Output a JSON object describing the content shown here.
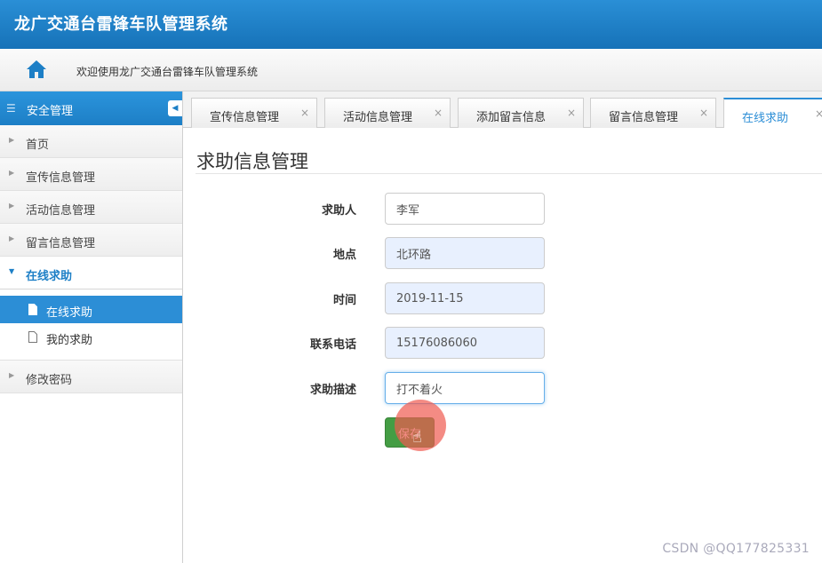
{
  "app": {
    "title": "龙广交通台雷锋车队管理系统"
  },
  "welcome": {
    "message": "欢迎使用龙广交通台雷锋车队管理系统",
    "icon": "home-icon",
    "icon_color": "#1d7fc6"
  },
  "sidebar": {
    "header": "安全管理",
    "items": [
      {
        "label": "首页"
      },
      {
        "label": "宣传信息管理"
      },
      {
        "label": "活动信息管理"
      },
      {
        "label": "留言信息管理"
      },
      {
        "label": "在线求助",
        "open": true
      },
      {
        "label": "修改密码"
      }
    ],
    "subitems": [
      {
        "label": "在线求助",
        "active": true
      },
      {
        "label": "我的求助"
      }
    ]
  },
  "tabs": [
    {
      "label": "宣传信息管理",
      "close": "×"
    },
    {
      "label": "活动信息管理",
      "close": "×"
    },
    {
      "label": "添加留言信息",
      "close": "×"
    },
    {
      "label": "留言信息管理",
      "close": "×"
    },
    {
      "label": "在线求助",
      "close": "×",
      "active": true
    }
  ],
  "page": {
    "title": "求助信息管理"
  },
  "form": {
    "fields": [
      {
        "label": "求助人",
        "value": "李军"
      },
      {
        "label": "地点",
        "value": "北环路"
      },
      {
        "label": "时间",
        "value": "2019-11-15"
      },
      {
        "label": "联系电话",
        "value": "15176086060"
      },
      {
        "label": "求助描述",
        "value": "打不着火"
      }
    ],
    "save_label": "保存"
  },
  "watermark": "CSDN @QQ177825331",
  "colors": {
    "primary": "#2c8ed6",
    "success": "#449d44",
    "header": "#1672b8"
  }
}
